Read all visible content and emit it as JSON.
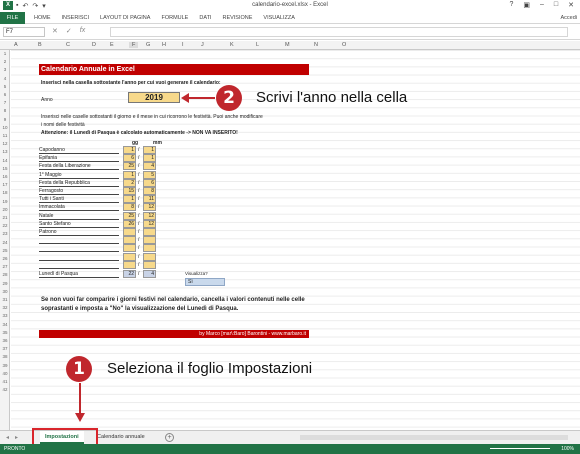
{
  "window": {
    "title": "calendario-excel.xlsx - Excel",
    "app_icon": "X"
  },
  "ribbon": {
    "file": "FILE",
    "tabs": [
      "HOME",
      "INSERISCI",
      "LAYOUT DI PAGINA",
      "FORMULE",
      "DATI",
      "REVISIONE",
      "VISUALIZZA"
    ],
    "account": "Accedi"
  },
  "formula_bar": {
    "name_box": "F7",
    "fx": "fx",
    "value": ""
  },
  "columns": [
    "A",
    "B",
    "C",
    "D",
    "E",
    "F",
    "G",
    "H",
    "I",
    "J",
    "K",
    "L",
    "M",
    "N",
    "O"
  ],
  "rows": [
    "1",
    "2",
    "3",
    "4",
    "5",
    "6",
    "7",
    "8",
    "9",
    "10",
    "11",
    "12",
    "13",
    "14",
    "15",
    "16",
    "17",
    "18",
    "19",
    "20",
    "21",
    "22",
    "23",
    "24",
    "25",
    "26",
    "27",
    "28",
    "29",
    "30",
    "31",
    "32",
    "33",
    "34",
    "35",
    "36",
    "37",
    "38",
    "39",
    "40",
    "41",
    "42"
  ],
  "sheet": {
    "title": "Calendario Annuale in Excel",
    "intro": "Inserisci nella casella sottostante l'anno per cui vuoi generare il calendario:",
    "year_label": "Anno",
    "year": "2019",
    "instr_1": "Inserisci nelle caselle sottostanti il giorno e il mese in cui ricorrono le festività. Puoi anche modificare",
    "instr_2": "i nomi delle festività",
    "warning": "Attenzione: il Lunedì di Pasqua è calcolato automaticamente -> NON VA INSERITO!",
    "col_gg": "gg",
    "col_mm": "mm",
    "holidays": [
      {
        "name": "Capodanno",
        "gg": "1",
        "mm": "1"
      },
      {
        "name": "Epifania",
        "gg": "6",
        "mm": "1"
      },
      {
        "name": "Festa della Liberazione",
        "gg": "25",
        "mm": "4"
      },
      {
        "name": "1° Maggio",
        "gg": "1",
        "mm": "5"
      },
      {
        "name": "Festa della Repubblica",
        "gg": "2",
        "mm": "6"
      },
      {
        "name": "Ferragosto",
        "gg": "15",
        "mm": "8"
      },
      {
        "name": "Tutti i Santi",
        "gg": "1",
        "mm": "11"
      },
      {
        "name": "Immacolata",
        "gg": "8",
        "mm": "12"
      },
      {
        "name": "Natale",
        "gg": "25",
        "mm": "12"
      },
      {
        "name": "Santo Stefano",
        "gg": "26",
        "mm": "12"
      },
      {
        "name": "Patrono",
        "gg": "",
        "mm": ""
      },
      {
        "name": "",
        "gg": "",
        "mm": ""
      },
      {
        "name": "",
        "gg": "",
        "mm": ""
      },
      {
        "name": "",
        "gg": "",
        "mm": ""
      },
      {
        "name": "",
        "gg": "",
        "mm": ""
      }
    ],
    "easter": {
      "name": "Lunedì di Pasqua",
      "gg": "22",
      "mm": "4"
    },
    "slash": "/",
    "visualizza_label": "Visualizza?",
    "visualizza_value": "Sì",
    "note": "Se non vuoi far comparire i giorni festivi nel calendario, cancella i valori contenuti nelle celle soprastanti e imposta a \"No\" la visualizzazione del Lunedì di Pasqua.",
    "credit": "by Marco [mar\\:Baro] Barontini - www.marbaro.it"
  },
  "callouts": {
    "step2_number": "2",
    "step2_text": "Scrivi l'anno nella cella",
    "step1_number": "1",
    "step1_text": "Seleziona il foglio Impostazioni"
  },
  "sheet_tabs": {
    "active": "Impostazioni",
    "other": "Calendario annuale",
    "add": "+"
  },
  "status_bar": {
    "ready": "PRONTO",
    "zoom": "100%"
  },
  "colors": {
    "excel_green": "#217346",
    "title_red": "#c00000",
    "input_yellow": "#f7d98b",
    "badge_red": "#c0272d",
    "highlight_red": "#d9252b"
  }
}
